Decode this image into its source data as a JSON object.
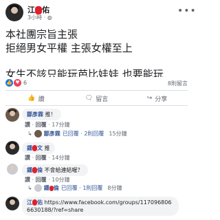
{
  "post": {
    "author_prefix": "江",
    "author_suffix": "佑",
    "time": "3小時",
    "lines": [
      "本社團宗旨主張",
      "拒絕男女平權 主張女權至上",
      "",
      "女生不該只能玩芭比娃娃 也要能玩"
    ],
    "reaction_count": "6",
    "views": "8則留言",
    "actions": {
      "like": "讚",
      "comment": "留言",
      "share": "分享"
    }
  },
  "comments": [
    {
      "name": "鄒彥霖",
      "text": "推！",
      "like": "讚",
      "reply": "回覆",
      "time": "17分鐘",
      "reply_preview": {
        "name": "鄒彥霖",
        "text": "已回覆 · 2則回覆",
        "time": "15分鐘"
      }
    },
    {
      "name_prefix": "鍾",
      "name_suffix": "文",
      "text": "推",
      "like": "讚",
      "reply": "回覆",
      "time": "14分鐘"
    },
    {
      "name_prefix": "鍾",
      "name_suffix": "倫",
      "text": "不會給連結喔？",
      "like": "讚",
      "reply": "回覆",
      "time": "10分鐘",
      "reply_preview": {
        "name_prefix": "鍾",
        "name_suffix": "倫",
        "text": "已回覆 · 1則回覆",
        "time": "8分鐘"
      }
    },
    {
      "name_prefix": "江",
      "name_suffix": "佑",
      "text": "https://www.facebook.com/groups/1170968066630188/?ref=share"
    }
  ],
  "icons": [
    "more-icon",
    "like-icon",
    "love-icon",
    "comment-icon",
    "share-icon",
    "reply-arrow-icon"
  ]
}
